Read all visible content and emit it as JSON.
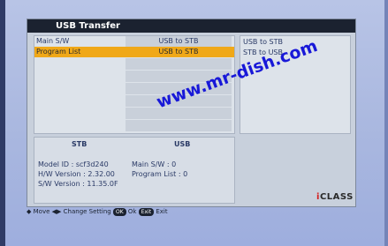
{
  "title": "USB Transfer",
  "rows": [
    {
      "label": "Main S/W",
      "value": "USB to STB",
      "selected": false
    },
    {
      "label": "Program List",
      "value": "USB to STB",
      "selected": true
    }
  ],
  "options": [
    "USB to STB",
    "STB to USB"
  ],
  "info": {
    "stb_header": "STB",
    "usb_header": "USB",
    "model": "Model ID : scf3d240",
    "hw": "H/W Version : 2.32.00",
    "sw": "S/W Version : 11.35.0F",
    "usb_main_sw": "Main S/W : 0",
    "usb_program_list": "Program List : 0"
  },
  "watermark": "www.mr-dish.com",
  "logo": {
    "first": "i",
    "rest": "CLASS"
  },
  "footer": {
    "move_icon": "◆",
    "move": "Move",
    "change_icon": "◀▶",
    "change": "Change Setting",
    "ok_key": "OK",
    "ok": "Ok",
    "exit_key": "Exit",
    "exit": "Exit"
  }
}
